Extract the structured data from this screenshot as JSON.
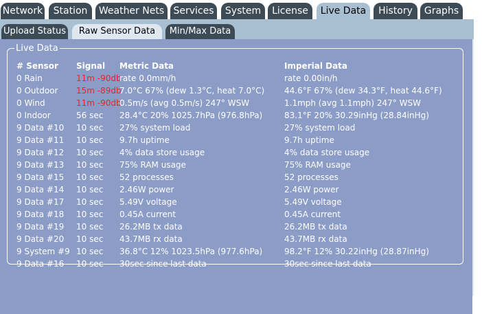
{
  "top_tabs": [
    {
      "label": "Network"
    },
    {
      "label": "Station"
    },
    {
      "label": "Weather Nets"
    },
    {
      "label": "Services"
    },
    {
      "label": "System"
    },
    {
      "label": "License"
    },
    {
      "label": "Live Data",
      "active": true
    },
    {
      "label": "History"
    },
    {
      "label": "Graphs"
    }
  ],
  "sub_tabs": [
    {
      "label": "Upload Status"
    },
    {
      "label": "Raw Sensor Data",
      "active": true
    },
    {
      "label": "Min/Max Data"
    }
  ],
  "live_data": {
    "legend": "Live Data",
    "headers": {
      "sensor": "# Sensor",
      "signal": "Signal",
      "metric": "Metric Data",
      "imperial": "Imperial Data"
    },
    "rows": [
      {
        "sensor": "0 Rain",
        "signal": "11m -90db",
        "metric": "rate 0.0mm/h",
        "imperial": "rate 0.00in/h",
        "alert": true
      },
      {
        "sensor": "0 Outdoor",
        "signal": "15m -89db",
        "metric": "7.0°C 67% (dew 1.3°C, heat 7.0°C)",
        "imperial": "44.6°F 67% (dew 34.3°F, heat 44.6°F)",
        "alert": true
      },
      {
        "sensor": "0 Wind",
        "signal": "11m -90db",
        "metric": "0.5m/s (avg 0.5m/s) 247° WSW",
        "imperial": "1.1mph (avg 1.1mph) 247° WSW",
        "alert": true
      },
      {
        "sensor": "0 Indoor",
        "signal": "56 sec",
        "metric": "28.4°C 20% 1025.7hPa (976.8hPa)",
        "imperial": "83.1°F 20% 30.29inHg (28.84inHg)"
      },
      {
        "sensor": "9 Data #10",
        "signal": "10 sec",
        "metric": "27% system load",
        "imperial": "27% system load"
      },
      {
        "sensor": "9 Data #11",
        "signal": "10 sec",
        "metric": "9.7h uptime",
        "imperial": "9.7h uptime"
      },
      {
        "sensor": "9 Data #12",
        "signal": "10 sec",
        "metric": "4% data store usage",
        "imperial": "4% data store usage"
      },
      {
        "sensor": "9 Data #13",
        "signal": "10 sec",
        "metric": "75% RAM usage",
        "imperial": "75% RAM usage"
      },
      {
        "sensor": "9 Data #15",
        "signal": "10 sec",
        "metric": "52 processes",
        "imperial": "52 processes"
      },
      {
        "sensor": "9 Data #14",
        "signal": "10 sec",
        "metric": "2.46W power",
        "imperial": "2.46W power"
      },
      {
        "sensor": "9 Data #17",
        "signal": "10 sec",
        "metric": "5.49V voltage",
        "imperial": "5.49V voltage"
      },
      {
        "sensor": "9 Data #18",
        "signal": "10 sec",
        "metric": "0.45A current",
        "imperial": "0.45A current"
      },
      {
        "sensor": "9 Data #19",
        "signal": "10 sec",
        "metric": "26.2MB tx data",
        "imperial": "26.2MB tx data"
      },
      {
        "sensor": "9 Data #20",
        "signal": "10 sec",
        "metric": "43.7MB rx data",
        "imperial": "43.7MB rx data"
      },
      {
        "sensor": "9 System #9",
        "signal": "10 sec",
        "metric": "36.8°C 12% 1023.5hPa (977.6hPa)",
        "imperial": "98.2°F 12% 30.22inHg (28.87inHg)"
      },
      {
        "sensor": "9 Data #16",
        "signal": "10 sec",
        "metric": "30sec since last data",
        "imperial": "30sec since last data"
      }
    ]
  },
  "colors": {
    "tab_bg": "#3c4b56",
    "panel_bg": "#8b9cc7",
    "signal_alert": "#e8242a"
  }
}
